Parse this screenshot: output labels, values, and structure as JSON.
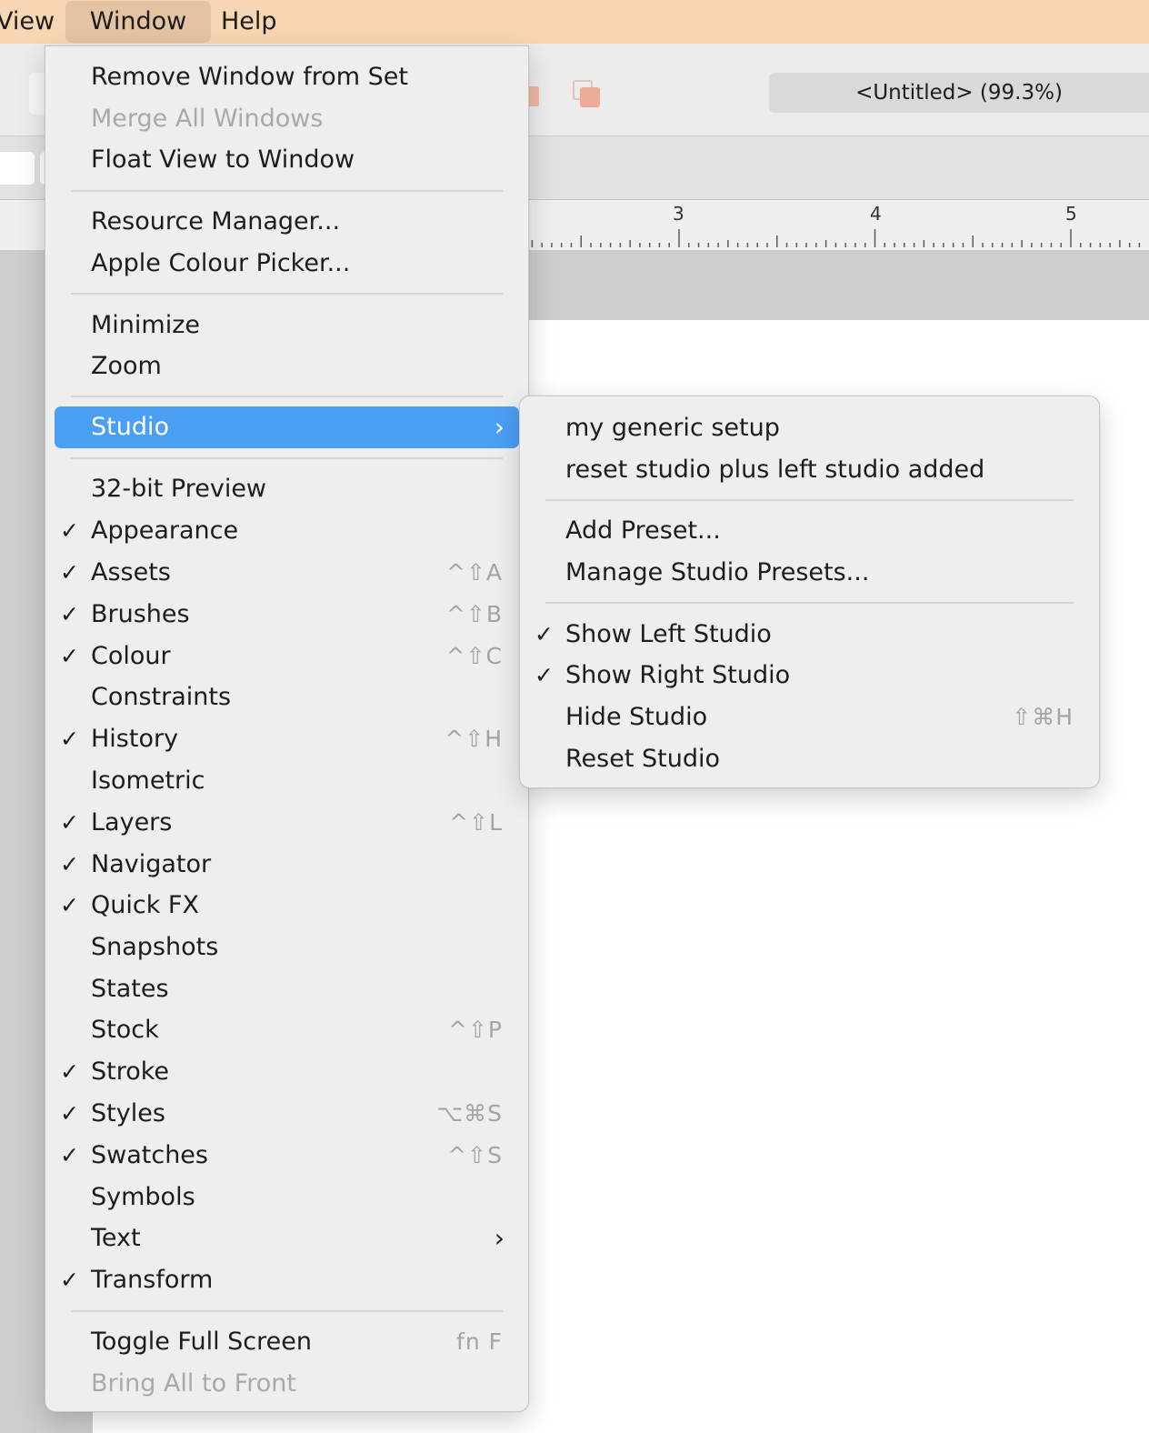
{
  "menubar": {
    "items": [
      {
        "label": "View"
      },
      {
        "label": "Window"
      },
      {
        "label": "Help"
      }
    ]
  },
  "toolbar": {
    "document_title": "<Untitled> (99.3%)"
  },
  "ruler": {
    "labels": [
      "3",
      "4",
      "5"
    ]
  },
  "window_menu": {
    "items": [
      {
        "label": "Remove Window from Set",
        "checked": false,
        "shortcut": "",
        "disabled": false
      },
      {
        "label": "Merge All Windows",
        "checked": false,
        "shortcut": "",
        "disabled": true
      },
      {
        "label": "Float View to Window",
        "checked": false,
        "shortcut": "",
        "disabled": false
      },
      {
        "label": "Resource Manager...",
        "checked": false,
        "shortcut": "",
        "disabled": false
      },
      {
        "label": "Apple Colour Picker...",
        "checked": false,
        "shortcut": "",
        "disabled": false
      },
      {
        "label": "Minimize",
        "checked": false,
        "shortcut": "",
        "disabled": false
      },
      {
        "label": "Zoom",
        "checked": false,
        "shortcut": "",
        "disabled": false
      },
      {
        "label": "Studio",
        "checked": false,
        "shortcut": "",
        "disabled": false,
        "submenu": true,
        "selected": true
      },
      {
        "label": "32-bit Preview",
        "checked": false,
        "shortcut": "",
        "disabled": false
      },
      {
        "label": "Appearance",
        "checked": true,
        "shortcut": "",
        "disabled": false
      },
      {
        "label": "Assets",
        "checked": true,
        "shortcut": "^⇧A",
        "disabled": false
      },
      {
        "label": "Brushes",
        "checked": true,
        "shortcut": "^⇧B",
        "disabled": false
      },
      {
        "label": "Colour",
        "checked": true,
        "shortcut": "^⇧C",
        "disabled": false
      },
      {
        "label": "Constraints",
        "checked": false,
        "shortcut": "",
        "disabled": false
      },
      {
        "label": "History",
        "checked": true,
        "shortcut": "^⇧H",
        "disabled": false
      },
      {
        "label": "Isometric",
        "checked": false,
        "shortcut": "",
        "disabled": false
      },
      {
        "label": "Layers",
        "checked": true,
        "shortcut": "^⇧L",
        "disabled": false
      },
      {
        "label": "Navigator",
        "checked": true,
        "shortcut": "",
        "disabled": false
      },
      {
        "label": "Quick FX",
        "checked": true,
        "shortcut": "",
        "disabled": false
      },
      {
        "label": "Snapshots",
        "checked": false,
        "shortcut": "",
        "disabled": false
      },
      {
        "label": "States",
        "checked": false,
        "shortcut": "",
        "disabled": false
      },
      {
        "label": "Stock",
        "checked": false,
        "shortcut": "^⇧P",
        "disabled": false
      },
      {
        "label": "Stroke",
        "checked": true,
        "shortcut": "",
        "disabled": false
      },
      {
        "label": "Styles",
        "checked": true,
        "shortcut": "⌥⌘S",
        "disabled": false
      },
      {
        "label": "Swatches",
        "checked": true,
        "shortcut": "^⇧S",
        "disabled": false
      },
      {
        "label": "Symbols",
        "checked": false,
        "shortcut": "",
        "disabled": false
      },
      {
        "label": "Text",
        "checked": false,
        "shortcut": "",
        "disabled": false,
        "submenu": true
      },
      {
        "label": "Transform",
        "checked": true,
        "shortcut": "",
        "disabled": false
      },
      {
        "label": "Toggle Full Screen",
        "checked": false,
        "shortcut": "fn F",
        "disabled": false
      },
      {
        "label": "Bring All to Front",
        "checked": false,
        "shortcut": "",
        "disabled": true
      }
    ]
  },
  "studio_submenu": {
    "items": [
      {
        "label": "my generic setup",
        "checked": false,
        "shortcut": ""
      },
      {
        "label": "reset studio plus left studio added",
        "checked": false,
        "shortcut": ""
      },
      {
        "label": "Add Preset...",
        "checked": false,
        "shortcut": ""
      },
      {
        "label": "Manage Studio Presets...",
        "checked": false,
        "shortcut": ""
      },
      {
        "label": "Show Left Studio",
        "checked": true,
        "shortcut": ""
      },
      {
        "label": "Show Right Studio",
        "checked": true,
        "shortcut": ""
      },
      {
        "label": "Hide Studio",
        "checked": false,
        "shortcut": "⇧⌘H"
      },
      {
        "label": "Reset Studio",
        "checked": false,
        "shortcut": ""
      }
    ]
  },
  "glyphs": {
    "check": "✓",
    "submenu_arrow": "›"
  },
  "icons": {
    "check": "checkmark-icon",
    "submenu": "chevron-right-icon"
  }
}
